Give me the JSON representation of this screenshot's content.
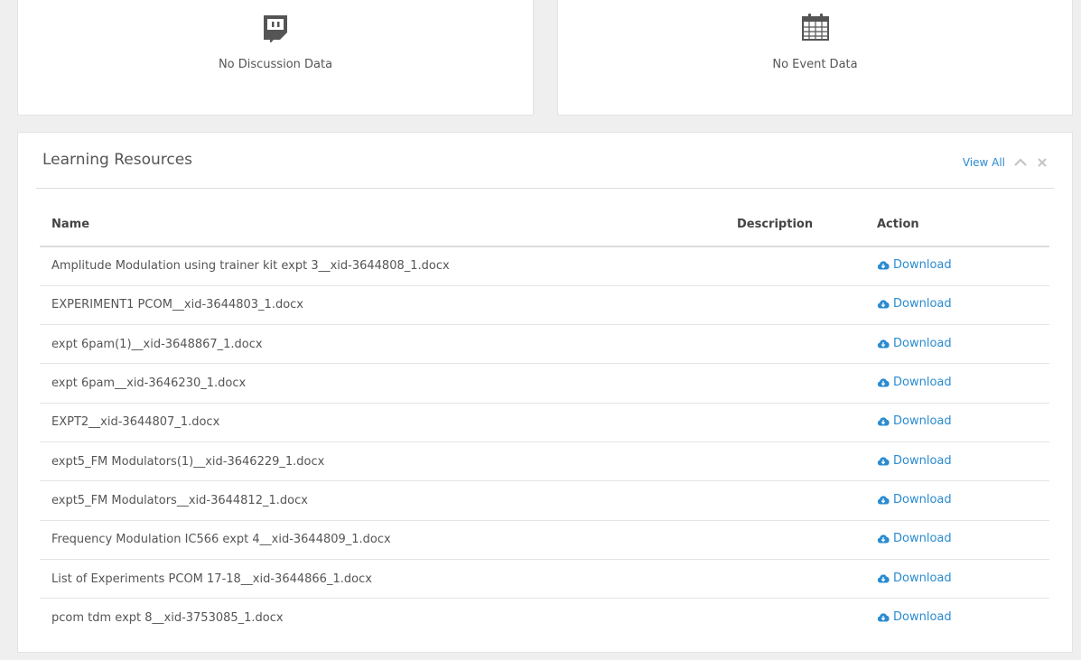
{
  "widgets": {
    "discussion": {
      "icon": "chat-bubble-icon",
      "empty_text": "No Discussion Data"
    },
    "events": {
      "icon": "calendar-icon",
      "empty_text": "No Event Data"
    }
  },
  "learning_resources": {
    "title": "Learning Resources",
    "view_all_label": "View All",
    "columns": {
      "name": "Name",
      "description": "Description",
      "action": "Action"
    },
    "action_label": "Download",
    "rows": [
      {
        "name": "Amplitude Modulation using trainer kit expt 3__xid-3644808_1.docx",
        "description": ""
      },
      {
        "name": "EXPERIMENT1 PCOM__xid-3644803_1.docx",
        "description": ""
      },
      {
        "name": "expt 6pam(1)__xid-3648867_1.docx",
        "description": ""
      },
      {
        "name": "expt 6pam__xid-3646230_1.docx",
        "description": ""
      },
      {
        "name": "EXPT2__xid-3644807_1.docx",
        "description": ""
      },
      {
        "name": "expt5_FM Modulators(1)__xid-3646229_1.docx",
        "description": ""
      },
      {
        "name": "expt5_FM Modulators__xid-3644812_1.docx",
        "description": ""
      },
      {
        "name": "Frequency Modulation IC566 expt 4__xid-3644809_1.docx",
        "description": ""
      },
      {
        "name": "List of Experiments PCOM 17-18__xid-3644866_1.docx",
        "description": ""
      },
      {
        "name": "pcom tdm expt 8__xid-3753085_1.docx",
        "description": ""
      }
    ]
  },
  "colors": {
    "link": "#2a8bd0",
    "icon": "#555555",
    "background": "#efefef"
  }
}
